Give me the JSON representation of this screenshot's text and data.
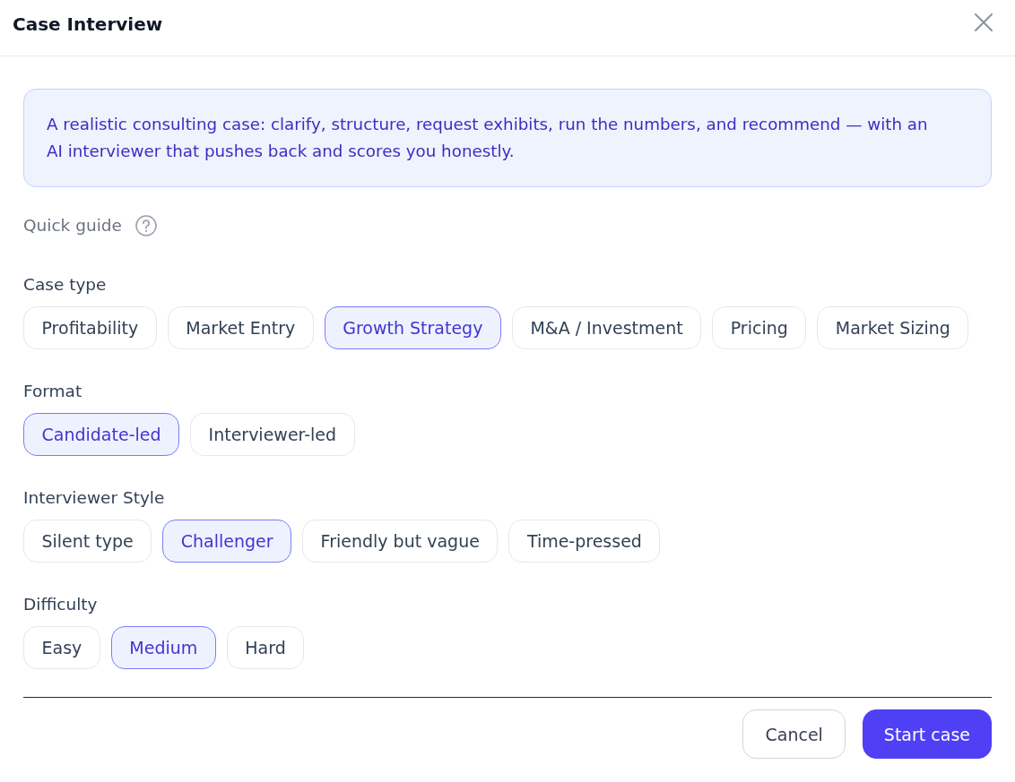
{
  "dialog": {
    "title": "Case Interview"
  },
  "intro": "A realistic consulting case: clarify, structure, request exhibits, run the numbers, and recommend — with an AI interviewer that pushes back and scores you honestly.",
  "quick_guide": {
    "label": "Quick guide"
  },
  "groups": [
    {
      "label": "Case type",
      "options": [
        {
          "label": "Profitability",
          "selected": false
        },
        {
          "label": "Market Entry",
          "selected": false
        },
        {
          "label": "Growth Strategy",
          "selected": true
        },
        {
          "label": "M&A / Investment",
          "selected": false
        },
        {
          "label": "Pricing",
          "selected": false
        },
        {
          "label": "Market Sizing",
          "selected": false
        }
      ]
    },
    {
      "label": "Format",
      "options": [
        {
          "label": "Candidate-led",
          "selected": true
        },
        {
          "label": "Interviewer-led",
          "selected": false
        }
      ]
    },
    {
      "label": "Interviewer Style",
      "options": [
        {
          "label": "Silent type",
          "selected": false
        },
        {
          "label": "Challenger",
          "selected": true
        },
        {
          "label": "Friendly but vague",
          "selected": false
        },
        {
          "label": "Time-pressed",
          "selected": false
        }
      ]
    },
    {
      "label": "Difficulty",
      "options": [
        {
          "label": "Easy",
          "selected": false
        },
        {
          "label": "Medium",
          "selected": true
        },
        {
          "label": "Hard",
          "selected": false
        }
      ]
    }
  ],
  "buttons": [
    {
      "label": "Cancel",
      "kind": "secondary"
    },
    {
      "label": "Start case",
      "kind": "primary"
    }
  ]
}
